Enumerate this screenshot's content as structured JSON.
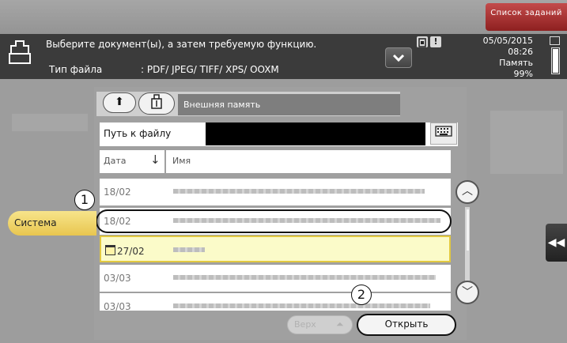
{
  "top": {
    "jobs_button": "Список заданий"
  },
  "header": {
    "message": "Выберите документ(ы), а затем требуемую функцию.",
    "file_type_label": "Тип файла",
    "file_type_value": ": PDF/ JPEG/ TIFF/ XPS/ OOXM",
    "date": "05/05/2015",
    "time": "08:26",
    "memory_label": "Память",
    "memory_value": "99%",
    "alert_icon_text": "!"
  },
  "browser": {
    "location": "Внешняя память",
    "path_label": "Путь к файлу",
    "column_date": "Дата",
    "column_name": "Имя",
    "files": [
      {
        "date": "18/02",
        "folder": false,
        "selected": false
      },
      {
        "date": "18/02",
        "folder": false,
        "selected": false
      },
      {
        "date": "27/02",
        "folder": true,
        "selected": true
      },
      {
        "date": "03/03",
        "folder": false,
        "selected": false
      },
      {
        "date": "03/03",
        "folder": false,
        "selected": false
      }
    ]
  },
  "side": {
    "system_button": "Система"
  },
  "callouts": {
    "one": "1",
    "two": "2"
  },
  "footer": {
    "top_button": "Верх",
    "open_button": "Открыть"
  },
  "icons": {
    "doc": "document-icon",
    "up": "up-arrow-icon",
    "usb": "usb-memory-icon",
    "keyboard": "keyboard-icon",
    "sort": "sort-down-arrow-icon",
    "scroll_up": "chevron-up-icon",
    "scroll_down": "chevron-down-icon",
    "collapse": "double-chevron-left-icon",
    "top": "double-chevron-up-icon",
    "folder": "folder-icon"
  },
  "colors": {
    "accent_yellow": "#e8c64f",
    "selection_row": "#fbfbc9",
    "jobs_red": "#b03535"
  }
}
